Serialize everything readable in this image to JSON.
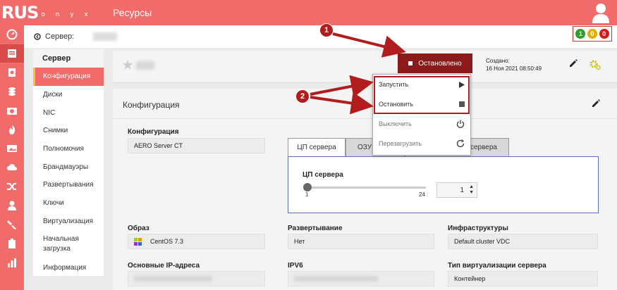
{
  "brand": {
    "main": "RUS",
    "sub": "ONYX",
    "subtext": "o n y x"
  },
  "header": {
    "title": "Ресурсы"
  },
  "rail_icons": [
    "dashboard-icon",
    "server-icon",
    "image-icon",
    "disk-icon",
    "camera-icon",
    "firewall-icon",
    "picture-icon",
    "cloud-icon",
    "shuffle-icon",
    "user-icon",
    "tools-icon",
    "clipboard-icon",
    "stats-icon"
  ],
  "breadcrumb": {
    "label": "Сервер:"
  },
  "badges": [
    {
      "value": "1",
      "color": "#2e9e2e"
    },
    {
      "value": "0",
      "color": "#e0b000"
    },
    {
      "value": "0",
      "color": "#d11a1a"
    }
  ],
  "submenu": {
    "title": "Сервер",
    "items": [
      "Конфигурация",
      "Диски",
      "NIC",
      "Снимки",
      "Полномочия",
      "Брандмауэры",
      "Развертывания",
      "Ключи",
      "Виртуализация",
      "Начальная загрузка",
      "Информация"
    ]
  },
  "server_header": {
    "status_label": "Остановлено",
    "created_label": "Создано:",
    "created_value": "16 Ноя 2021 08:50:49"
  },
  "dropdown": {
    "items": [
      {
        "label": "Запустить",
        "icon": "play-icon"
      },
      {
        "label": "Остановить",
        "icon": "stop-icon"
      },
      {
        "label": "Выключить",
        "icon": "power-icon"
      },
      {
        "label": "Перезагрузить",
        "icon": "restart-icon"
      }
    ]
  },
  "config": {
    "title": "Конфигурация",
    "config_label": "Конфигурация",
    "config_value": "AERO Server CT",
    "tabs": [
      "ЦП сервера",
      "ОЗУ с",
      "сервера"
    ],
    "cpu_label": "ЦП сервера",
    "slider_min": "1",
    "slider_max": "24",
    "slider_value": "1",
    "image_label": "Образ",
    "image_value": "CentOS 7.3",
    "deploy_label": "Развертывание",
    "deploy_value": "Нет",
    "infra_label": "Инфраструктуры",
    "infra_value": "Default cluster VDC",
    "ip_label": "Основные IP-адреса",
    "ipv6_label": "IPV6",
    "virt_label": "Тип виртуализации сервера",
    "virt_value": "Контейнер"
  },
  "callouts": [
    "1",
    "2"
  ],
  "colors": {
    "accent": "#f26b6b",
    "status": "#8b1a1a",
    "annotation": "#b11c1c"
  }
}
